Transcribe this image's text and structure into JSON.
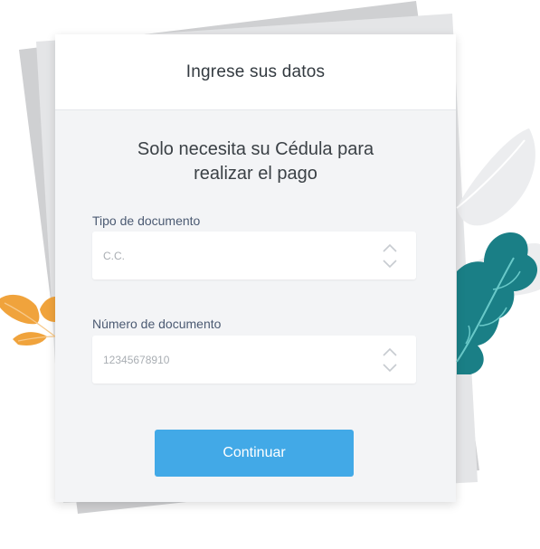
{
  "header": {
    "title": "Ingrese sus datos"
  },
  "form": {
    "subtitle": "Solo necesita su Cédula para realizar el pago",
    "document_type": {
      "label": "Tipo de documento",
      "value": "C.C."
    },
    "document_number": {
      "label": "Número de documento",
      "value": "12345678910"
    },
    "continue_label": "Continuar"
  },
  "colors": {
    "accent": "#42a9e7",
    "leaf_teal": "#1a7f86",
    "leaf_orange": "#f0a33c",
    "leaf_grey": "#ecedef"
  }
}
